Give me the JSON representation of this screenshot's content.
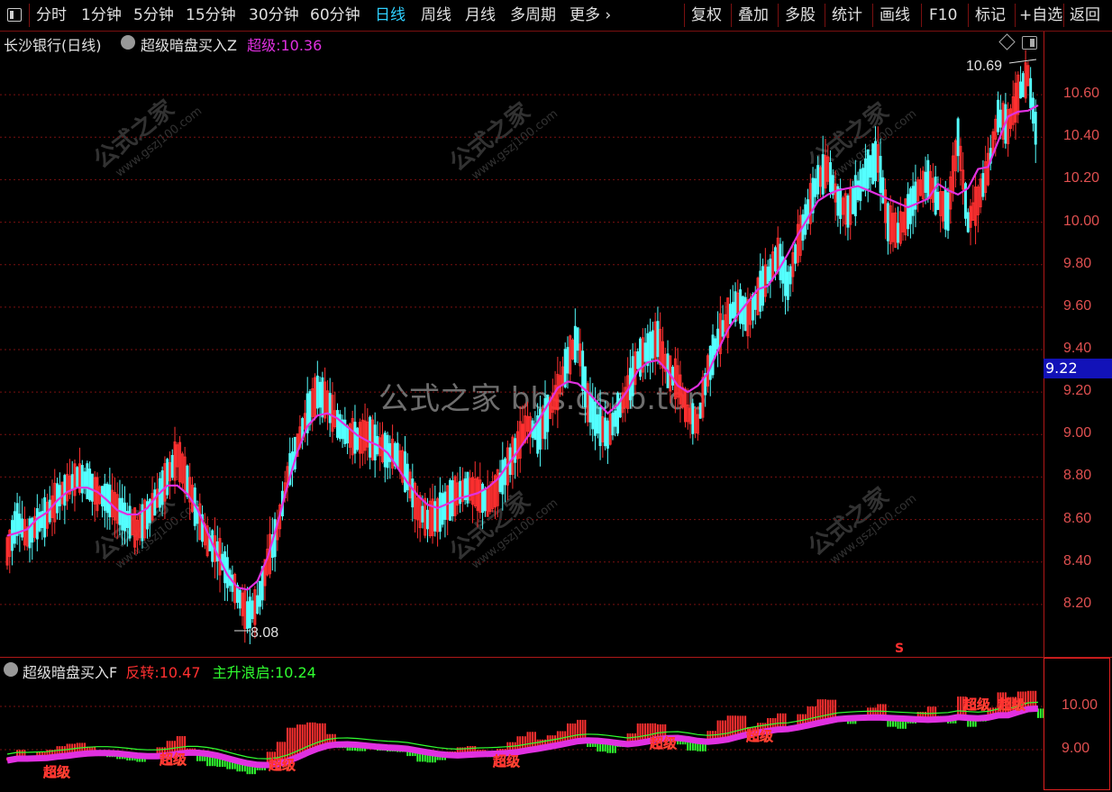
{
  "toolbar": {
    "left_items": [
      "分时",
      "1分钟",
      "5分钟",
      "15分钟",
      "30分钟",
      "60分钟",
      "日线",
      "周线",
      "月线",
      "多周期",
      "更多"
    ],
    "active": "日线",
    "right_items": [
      "复权",
      "叠加",
      "多股",
      "统计",
      "画线",
      "F10",
      "标记",
      "+自选",
      "返回"
    ]
  },
  "chart_header": {
    "stock": "长沙银行(日线)",
    "indicator": "超级暗盘买入Z",
    "series_label": "超级:",
    "series_value": "10.36"
  },
  "sub_header": {
    "indicator": "超级暗盘买入F",
    "label1": "反转:",
    "value1": "10.47",
    "label2": "主升浪启:",
    "value2": "10.24"
  },
  "price_axis": [
    "10.60",
    "10.40",
    "10.20",
    "10.00",
    "9.80",
    "9.60",
    "9.40",
    "9.20",
    "9.00",
    "8.80",
    "8.60",
    "8.40",
    "8.20"
  ],
  "sub_axis": [
    "10.00",
    "9.00"
  ],
  "current_price": "9.22",
  "annotations": {
    "high": "10.69",
    "low": "8.08",
    "signal": "S"
  },
  "sub_signal_label": "超级",
  "watermark": {
    "center": "公式之家 bbs.gszb.top",
    "diag_main": "公式之家",
    "diag_sub": "www.gszj100.com"
  },
  "colors": {
    "up": "#ff3030",
    "down": "#54ffff",
    "ma": "#e030e0",
    "sub_green": "#30ff30",
    "grid": "#7a1010"
  },
  "chart_data": {
    "type": "candlestick",
    "ylim": [
      8.0,
      10.8
    ],
    "closes": [
      8.45,
      8.6,
      8.52,
      8.58,
      8.62,
      8.7,
      8.75,
      8.8,
      8.78,
      8.72,
      8.7,
      8.65,
      8.6,
      8.55,
      8.62,
      8.7,
      8.8,
      8.9,
      8.78,
      8.62,
      8.5,
      8.45,
      8.35,
      8.25,
      8.15,
      8.2,
      8.4,
      8.55,
      8.8,
      8.95,
      9.1,
      9.2,
      9.15,
      9.05,
      9.0,
      8.98,
      9.0,
      8.95,
      8.92,
      8.9,
      8.8,
      8.65,
      8.6,
      8.62,
      8.68,
      8.72,
      8.75,
      8.72,
      8.68,
      8.75,
      8.85,
      8.95,
      9.05,
      9.0,
      9.1,
      9.2,
      9.35,
      9.45,
      9.15,
      9.05,
      9.0,
      9.1,
      9.2,
      9.35,
      9.4,
      9.45,
      9.3,
      9.25,
      9.1,
      9.05,
      9.3,
      9.45,
      9.55,
      9.62,
      9.55,
      9.65,
      9.75,
      9.85,
      9.7,
      9.9,
      10.05,
      10.2,
      10.25,
      10.1,
      10.05,
      10.15,
      10.25,
      10.3,
      10.0,
      9.95,
      10.05,
      10.15,
      10.2,
      10.1,
      10.05,
      10.4,
      10.0,
      10.1,
      10.25,
      10.5,
      10.45,
      10.6,
      10.69,
      10.36
    ],
    "ma_title": "超级",
    "ma_last": 10.36
  }
}
